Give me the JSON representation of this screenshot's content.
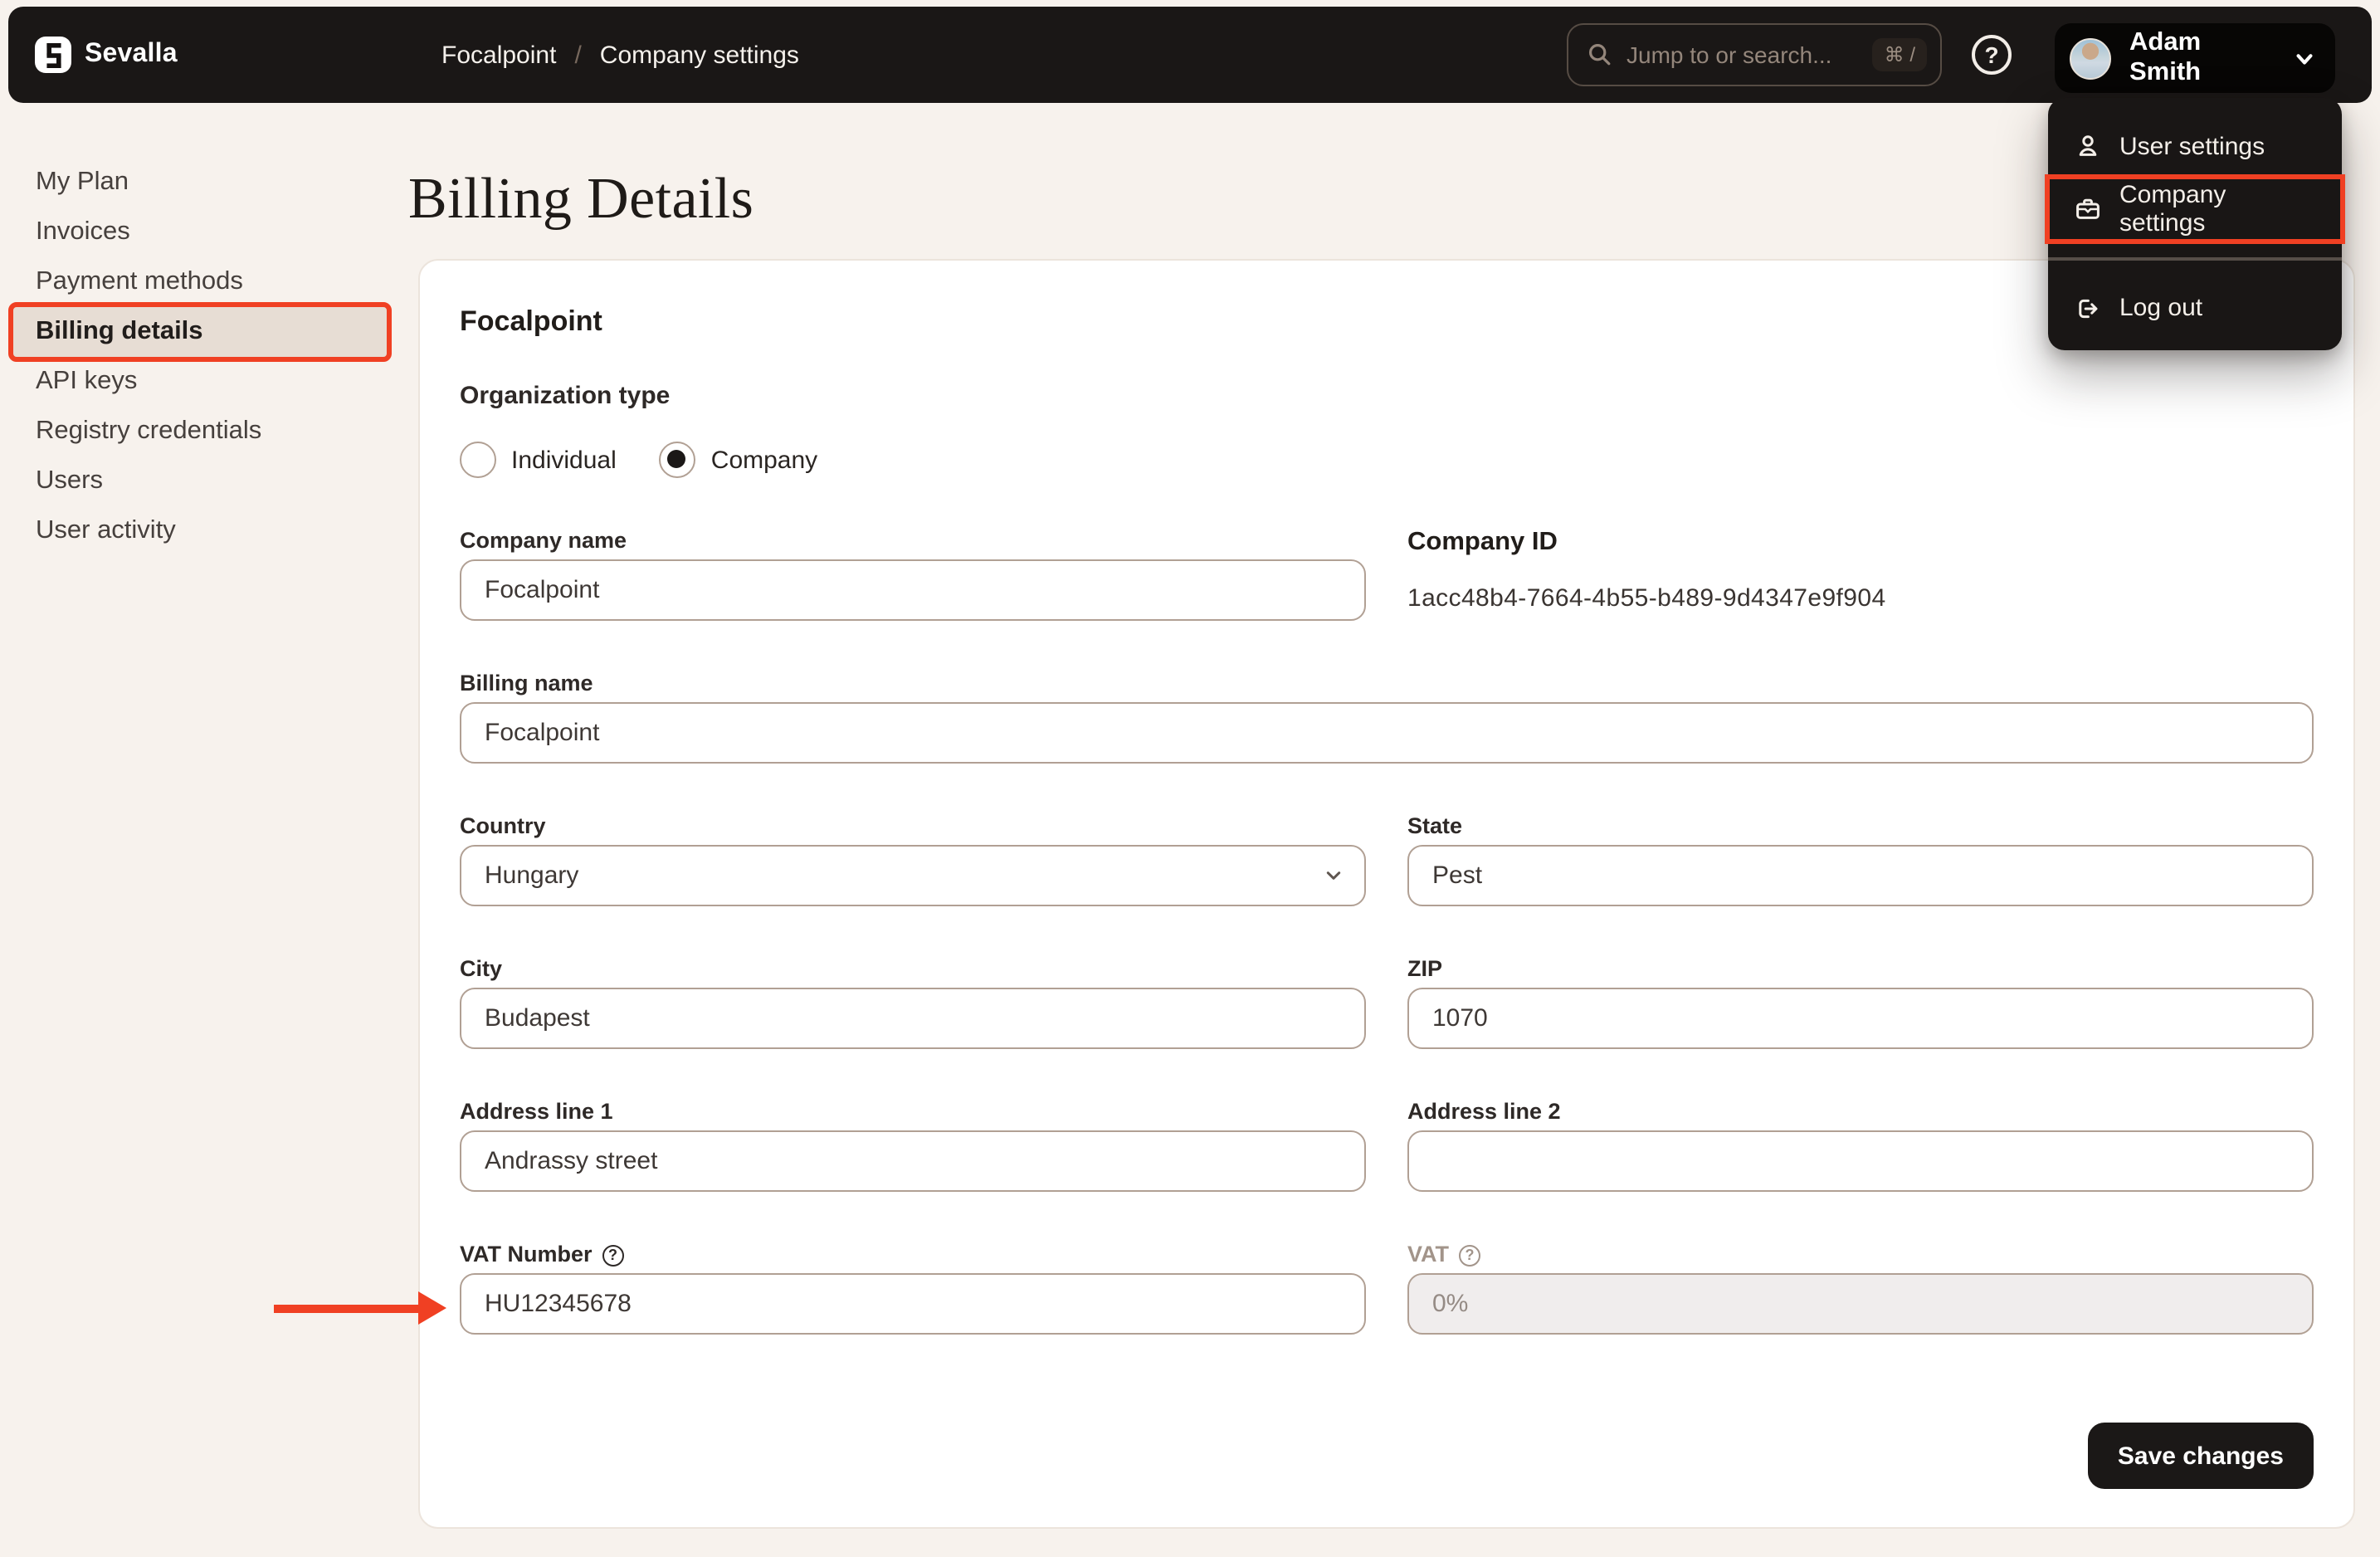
{
  "topbar": {
    "brand": "Sevalla",
    "breadcrumb": {
      "parent": "Focalpoint",
      "separator": "/",
      "current": "Company settings"
    },
    "search": {
      "placeholder": "Jump to or search...",
      "shortcut": "⌘ /"
    },
    "help_label": "?",
    "user": {
      "name": "Adam Smith"
    }
  },
  "user_menu": {
    "items": [
      {
        "label": "User settings",
        "icon": "user-icon",
        "highlighted": false
      },
      {
        "label": "Company settings",
        "icon": "briefcase-icon",
        "highlighted": true
      },
      {
        "label": "Log out",
        "icon": "logout-icon",
        "highlighted": false
      }
    ]
  },
  "sidebar": {
    "items": [
      {
        "label": "My Plan",
        "active": false
      },
      {
        "label": "Invoices",
        "active": false
      },
      {
        "label": "Payment methods",
        "active": false
      },
      {
        "label": "Billing details",
        "active": true,
        "annotated": true
      },
      {
        "label": "API keys",
        "active": false
      },
      {
        "label": "Registry credentials",
        "active": false
      },
      {
        "label": "Users",
        "active": false
      },
      {
        "label": "User activity",
        "active": false
      }
    ]
  },
  "page": {
    "title": "Billing Details"
  },
  "card": {
    "company_title": "Focalpoint",
    "organization_type": {
      "label": "Organization type",
      "options": [
        {
          "label": "Individual",
          "selected": false
        },
        {
          "label": "Company",
          "selected": true
        }
      ]
    },
    "fields": {
      "company_name": {
        "label": "Company name",
        "value": "Focalpoint"
      },
      "company_id": {
        "label": "Company ID",
        "value": "1acc48b4-7664-4b55-b489-9d4347e9f904"
      },
      "billing_name": {
        "label": "Billing name",
        "value": "Focalpoint"
      },
      "country": {
        "label": "Country",
        "value": "Hungary"
      },
      "state": {
        "label": "State",
        "value": "Pest"
      },
      "city": {
        "label": "City",
        "value": "Budapest"
      },
      "zip": {
        "label": "ZIP",
        "value": "1070"
      },
      "address1": {
        "label": "Address line 1",
        "value": "Andrassy street"
      },
      "address2": {
        "label": "Address line 2",
        "value": ""
      },
      "vat_number": {
        "label": "VAT Number",
        "value": "HU12345678"
      },
      "vat": {
        "label": "VAT",
        "value": "0%",
        "disabled": true
      }
    },
    "save_button": "Save changes"
  },
  "colors": {
    "annotation_red": "#f04023",
    "topbar_bg": "#1a1716",
    "page_bg": "#f7f2ed",
    "active_item_bg": "#e7ddd4"
  }
}
